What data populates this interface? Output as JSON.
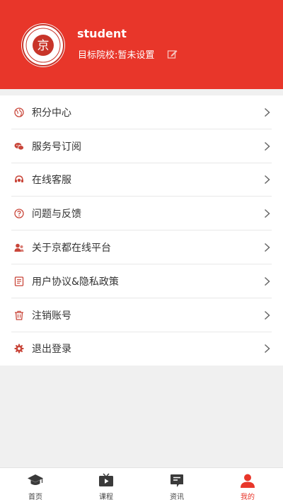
{
  "profile": {
    "username": "student",
    "school_line": "目标院校:暂未设置",
    "logo_text": "京"
  },
  "menu": [
    {
      "label": "积分中心",
      "icon": "points-globe-icon"
    },
    {
      "label": "服务号订阅",
      "icon": "wechat-icon"
    },
    {
      "label": "在线客服",
      "icon": "headset-icon"
    },
    {
      "label": "问题与反馈",
      "icon": "question-icon"
    },
    {
      "label": "关于京都在线平台",
      "icon": "about-users-icon"
    },
    {
      "label": "用户协议&隐私政策",
      "icon": "document-icon"
    },
    {
      "label": "注销账号",
      "icon": "trash-icon"
    },
    {
      "label": "退出登录",
      "icon": "gear-icon"
    }
  ],
  "tabs": [
    {
      "label": "首页",
      "icon": "graduation-cap-icon",
      "active": false
    },
    {
      "label": "课程",
      "icon": "tv-play-icon",
      "active": false
    },
    {
      "label": "资讯",
      "icon": "news-icon",
      "active": false
    },
    {
      "label": "我的",
      "icon": "user-icon",
      "active": true
    }
  ],
  "colors": {
    "accent": "#e8362a",
    "background": "#f0f0f0",
    "menu_icon": "#c9463a"
  }
}
